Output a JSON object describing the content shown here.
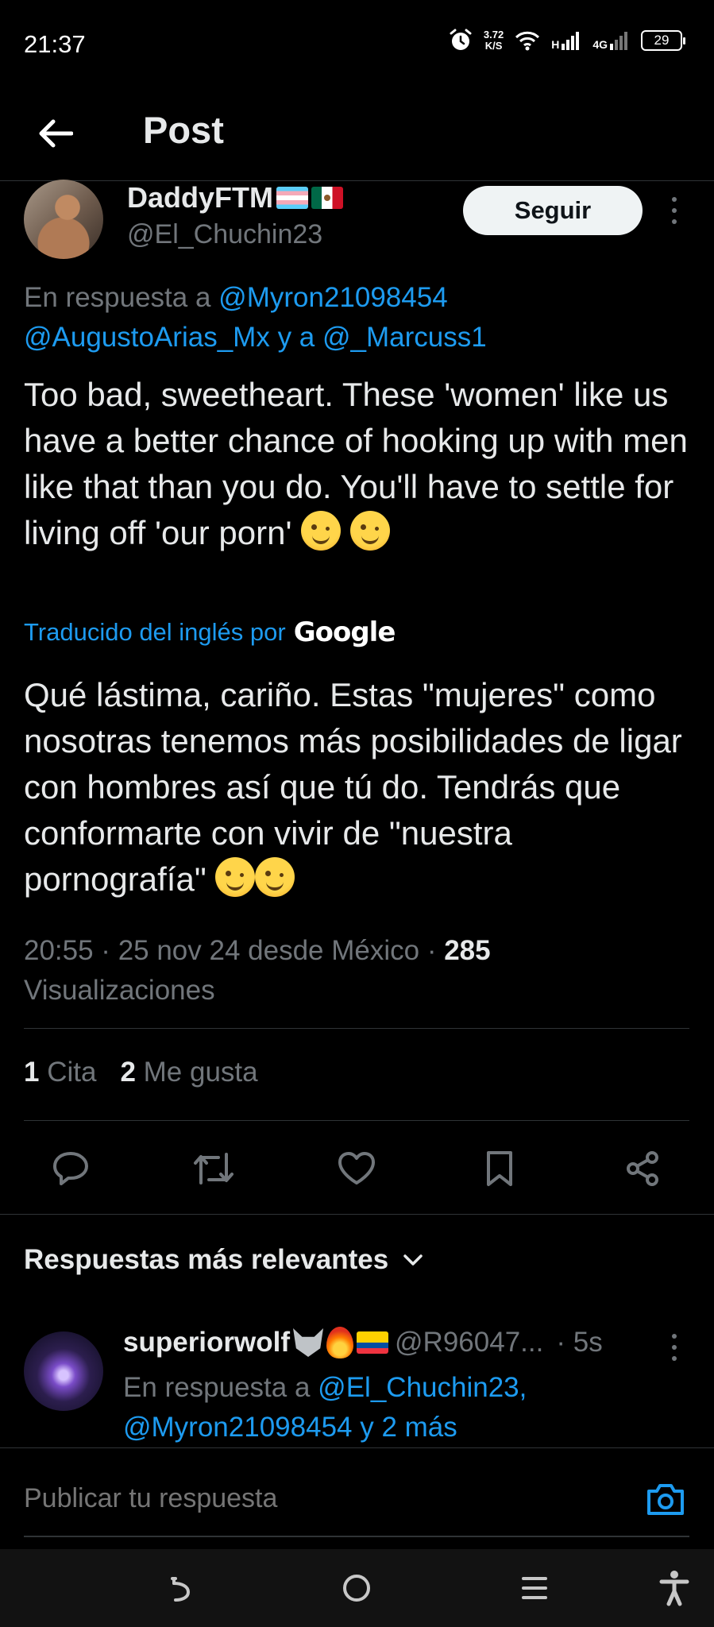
{
  "status_bar": {
    "time": "21:37",
    "speed_value": "3.72",
    "speed_unit": "K/S",
    "net_1": "H",
    "net_2": "4G",
    "battery": "29",
    "icons": [
      "alarm-icon",
      "wifi-icon",
      "signal-icon",
      "signal-icon",
      "battery-icon"
    ]
  },
  "header": {
    "title": "Post"
  },
  "post": {
    "author_name": "DaddyFTM",
    "author_handle": "@El_Chuchin23",
    "follow_label": "Seguir",
    "reply_prefix": "En respuesta a",
    "reply_mention_1": "@Myron21098454",
    "reply_mention_2": "@AugustoArias_Mx",
    "reply_join": "y a",
    "reply_mention_3": "@_Marcuss1",
    "text": "Too bad, sweetheart. These 'women' like us have a better chance of hooking up with men like that than you do. You'll have to settle for living off 'our porn'",
    "translated_label": "Traducido del inglés por",
    "translator": "Google",
    "translation": "Qué lástima, cariño. Estas \"mujeres\" como nosotras tenemos más posibilidades de ligar con hombres así que tú do. Tendrás que conformarte con vivir de \"nuestra pornografía\"",
    "time_date": "20:55 · 25 nov 24 desde México ·",
    "views_count": "285",
    "views_label": "Visualizaciones",
    "quotes_count": "1",
    "quotes_label": "Cita",
    "likes_count": "2",
    "likes_label": "Me gusta"
  },
  "actions": [
    "reply-icon",
    "retweet-icon",
    "like-icon",
    "bookmark-icon",
    "share-icon"
  ],
  "replies_sort_label": "Respuestas más relevantes",
  "reply": {
    "name": "superiorwolf",
    "handle": "@R96047...",
    "time": "· 5s",
    "reply_prefix": "En respuesta a",
    "mention_1": "@El_Chuchin23,",
    "mention_2": "@Myron21098454",
    "more": "y 2 más"
  },
  "compose": {
    "placeholder": "Publicar tu respuesta"
  },
  "colors": {
    "background": "#000000",
    "text": "#e7e9ea",
    "secondary": "#71767b",
    "accent": "#1d9bf0",
    "divider": "#2f3336"
  }
}
